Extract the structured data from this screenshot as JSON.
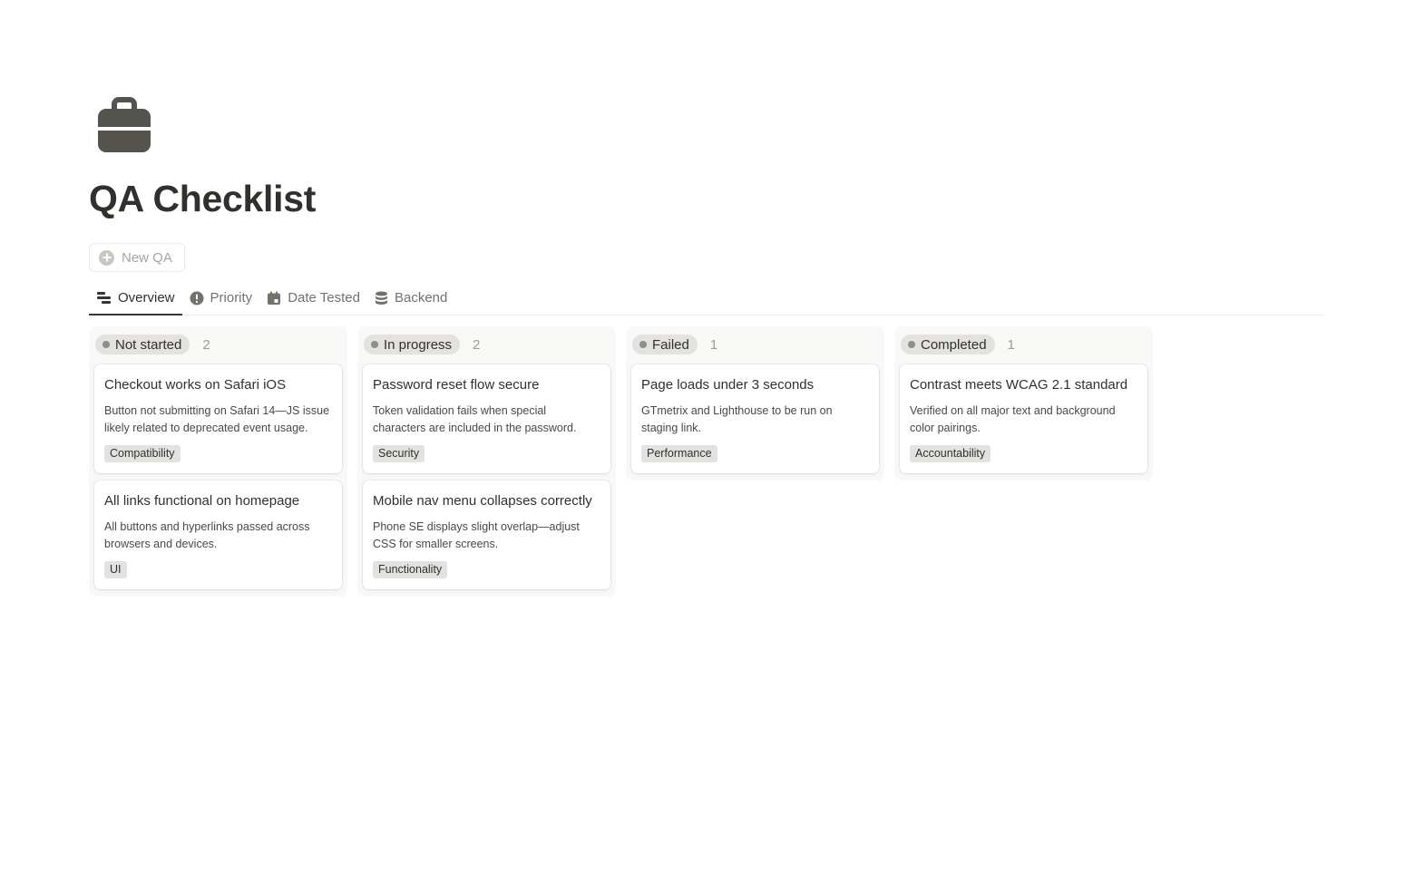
{
  "page": {
    "title": "QA Checklist",
    "icon": "briefcase-icon"
  },
  "toolbar": {
    "new_label": "New QA"
  },
  "tabs": [
    {
      "label": "Overview",
      "icon": "board-icon",
      "active": true
    },
    {
      "label": "Priority",
      "icon": "alert-circle-icon",
      "active": false
    },
    {
      "label": "Date Tested",
      "icon": "calendar-icon",
      "active": false
    },
    {
      "label": "Backend",
      "icon": "database-icon",
      "active": false
    }
  ],
  "columns": [
    {
      "status": "Not started",
      "count": "2",
      "cards": [
        {
          "title": "Checkout works on Safari iOS",
          "description": "Button not submitting on Safari 14—JS issue likely related to deprecated event usage.",
          "tag": "Compatibility"
        },
        {
          "title": "All links functional on homepage",
          "description": "All buttons and hyperlinks passed across browsers and devices.",
          "tag": "UI"
        }
      ]
    },
    {
      "status": "In progress",
      "count": "2",
      "cards": [
        {
          "title": "Password reset flow secure",
          "description": "Token validation fails when special characters are included in the password.",
          "tag": "Security"
        },
        {
          "title": "Mobile nav menu collapses correctly",
          "description": "Phone SE displays slight overlap—adjust CSS for smaller screens.",
          "tag": "Functionality"
        }
      ]
    },
    {
      "status": "Failed",
      "count": "1",
      "cards": [
        {
          "title": "Page loads under 3 seconds",
          "description": "GTmetrix and Lighthouse to be run on staging link.",
          "tag": "Performance"
        }
      ]
    },
    {
      "status": "Completed",
      "count": "1",
      "cards": [
        {
          "title": "Contrast meets WCAG 2.1 standard",
          "description": "Verified on all major text and background color pairings.",
          "tag": "Accountability"
        }
      ]
    }
  ],
  "colors": {
    "text": "#37352f",
    "pill_bg": "#e3e2e0",
    "column_bg": "#f8f8f6"
  }
}
